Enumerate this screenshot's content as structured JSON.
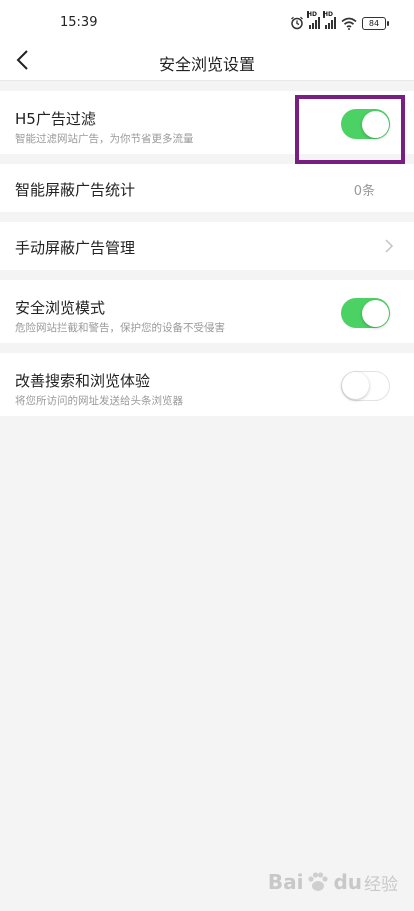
{
  "status_bar": {
    "time": "15:39",
    "signal_badges": [
      "HD",
      "HD"
    ],
    "battery": "84",
    "icons": [
      "alarm-icon",
      "signal-icon",
      "signal-icon",
      "wifi-icon",
      "battery-icon"
    ]
  },
  "nav": {
    "title": "安全浏览设置",
    "back_icon": "back-chevron-icon"
  },
  "settings": [
    {
      "label": "H5广告过滤",
      "desc": "智能过滤网站广告，为你节省更多流量",
      "toggle": true
    },
    {
      "label": "智能屏蔽广告统计",
      "value": "0条"
    },
    {
      "label": "手动屏蔽广告管理",
      "chevron": "chevron-right-icon"
    },
    {
      "label": "安全浏览模式",
      "desc": "危险网站拦截和警告，保护您的设备不受侵害",
      "toggle": true
    },
    {
      "label": "改善搜索和浏览体验",
      "desc": "将您所访问的网址发送给头条浏览器",
      "toggle": false
    }
  ],
  "watermark": {
    "brand": "Bai",
    "brand_tail": "du",
    "cn": "经验"
  },
  "colors": {
    "toggle_on": "#4cd264",
    "highlight_border": "#7a1f82",
    "background": "#f4f4f4"
  }
}
